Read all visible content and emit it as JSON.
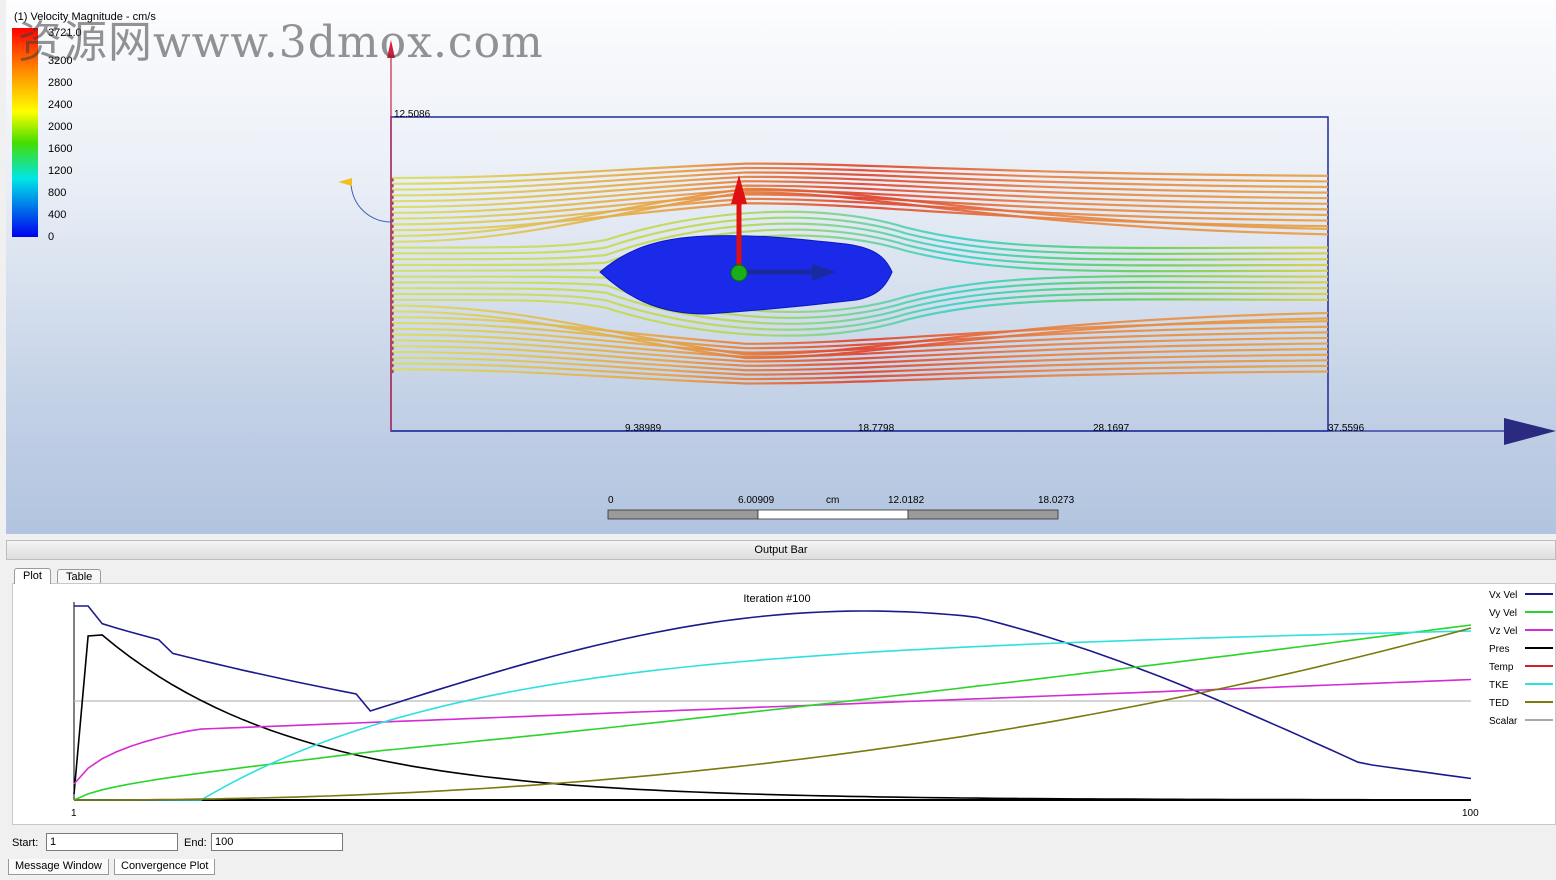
{
  "viewport": {
    "legend": {
      "title": "(1) Velocity Magnitude - cm/s",
      "max_value": "3721.0",
      "ticks": [
        "3200",
        "2800",
        "2400",
        "2000",
        "1600",
        "1200",
        "800",
        "400",
        "0"
      ]
    },
    "axis_labels": {
      "y_top": "12.5086",
      "x_ticks": [
        "9.38989",
        "18.7798",
        "28.1697",
        "37.5596"
      ]
    },
    "scale_bar": {
      "labels": [
        "0",
        "6.00909",
        "cm",
        "12.0182",
        "18.0273"
      ]
    },
    "watermark": "资源网www.3dmox.com"
  },
  "output_bar": {
    "title": "Output Bar"
  },
  "tabs": {
    "plot": "Plot",
    "table": "Table"
  },
  "plot": {
    "title": "Iteration #100",
    "x_start_label": "1",
    "x_end_label": "100",
    "legend": [
      {
        "name": "Vx Vel",
        "color": "#1a1a8c"
      },
      {
        "name": "Vy Vel",
        "color": "#2bd42b"
      },
      {
        "name": "Vz Vel",
        "color": "#d42bd4"
      },
      {
        "name": "Pres",
        "color": "#000000"
      },
      {
        "name": "Temp",
        "color": "#d42020"
      },
      {
        "name": "TKE",
        "color": "#30e0e0"
      },
      {
        "name": "TED",
        "color": "#7a7a10"
      },
      {
        "name": "Scalar",
        "color": "#aaaaaa"
      }
    ]
  },
  "range": {
    "start_label": "Start:",
    "start_value": "1",
    "end_label": "End:",
    "end_value": "100"
  },
  "bottom_tabs": {
    "message": "Message Window",
    "convergence": "Convergence Plot"
  }
}
